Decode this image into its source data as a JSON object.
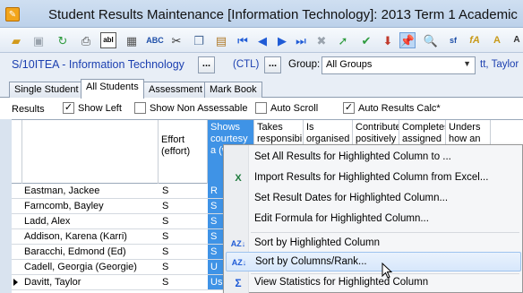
{
  "window": {
    "title": "Student Results Maintenance  [Information Technology]:  2013 Term 1 Academic"
  },
  "toolbar": {
    "icons": [
      "folder-open",
      "save",
      "refresh",
      "print",
      "abl",
      "calculator",
      "spellcheck",
      "cut",
      "copy",
      "paste",
      "first",
      "previous",
      "next",
      "last",
      "delete",
      "tick-arrow",
      "tick-file",
      "import",
      "pin",
      "preview",
      "text-sf",
      "text-fa",
      "text-a"
    ]
  },
  "selector": {
    "class_code": "S/10ITEA - Information Technology",
    "ellipsis": "...",
    "ctl": "(CTL)",
    "group_label": "Group:",
    "group_value": "All Groups",
    "teacher": "tt, Taylor"
  },
  "tabs": [
    "Single Student",
    "All Students",
    "Assessment",
    "Mark Book"
  ],
  "active_tab": "All Students",
  "controls": {
    "results_label": "Results",
    "show_left": {
      "label": "Show Left",
      "checked": true
    },
    "show_non_assessable": {
      "label": "Show Non Assessable",
      "checked": false
    },
    "auto_scroll": {
      "label": "Auto Scroll",
      "checked": false
    },
    "auto_results_calc": {
      "label": "Auto Results Calc*",
      "checked": true
    }
  },
  "grid": {
    "headers": [
      {
        "text": "Effort (effort)"
      },
      {
        "text": "Shows courtesy a (wo"
      },
      {
        "text": "Takes responsibi"
      },
      {
        "text": "Is organised"
      },
      {
        "text": "Contribute positively"
      },
      {
        "text": "Completes assigned t"
      },
      {
        "text": "Unders how an"
      }
    ],
    "rows": [
      {
        "name": "Eastman, Jackee",
        "effort": "S",
        "courtesy": "R"
      },
      {
        "name": "Farncomb, Bayley",
        "effort": "S",
        "courtesy": "S"
      },
      {
        "name": "Ladd, Alex",
        "effort": "S",
        "courtesy": "S"
      },
      {
        "name": "Addison, Karena (Karri)",
        "effort": "S",
        "courtesy": "S"
      },
      {
        "name": "Baracchi, Edmond (Ed)",
        "effort": "S",
        "courtesy": "S"
      },
      {
        "name": "Cadell, Georgia (Georgie)",
        "effort": "S",
        "courtesy": "U"
      },
      {
        "name": "Davitt, Taylor",
        "effort": "S",
        "courtesy": "Usu"
      }
    ],
    "current_row": 6
  },
  "context_menu": {
    "items": [
      {
        "label": "Set All Results for Highlighted Column to ...",
        "icon": ""
      },
      {
        "label": "Import Results for Highlighted Column from Excel...",
        "icon": "excel-icon"
      },
      {
        "label": "Set Result Dates for Highlighted Column...",
        "icon": ""
      },
      {
        "label": "Edit Formula for Highlighted Column...",
        "icon": ""
      },
      {
        "label": "Sort by Highlighted Column",
        "icon": "sort-az-icon"
      },
      {
        "label": "Sort by Columns/Rank...",
        "icon": "sort-az-icon"
      },
      {
        "label": "View Statistics for Highlighted Column",
        "icon": "sigma-icon"
      }
    ],
    "hovered_index": 5
  }
}
